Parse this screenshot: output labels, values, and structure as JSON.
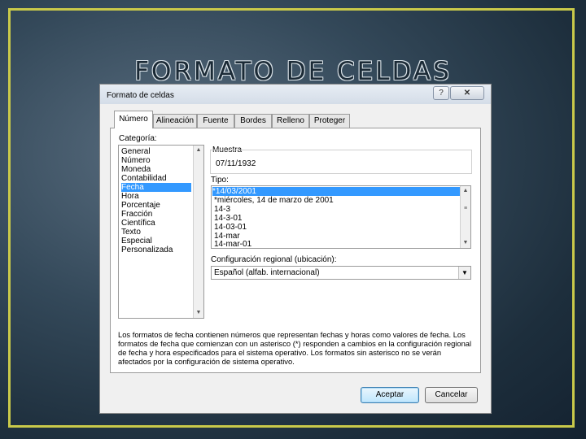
{
  "slide": {
    "title": "FORMATO DE CELDAS"
  },
  "dialog": {
    "title": "Formato de celdas",
    "help_button": "?",
    "close_button": "✕",
    "tabs": [
      "Número",
      "Alineación",
      "Fuente",
      "Bordes",
      "Relleno",
      "Proteger"
    ],
    "category_label": "Categoría:",
    "categories": [
      "General",
      "Número",
      "Moneda",
      "Contabilidad",
      "Fecha",
      "Hora",
      "Porcentaje",
      "Fracción",
      "Científica",
      "Texto",
      "Especial",
      "Personalizada"
    ],
    "selected_category": "Fecha",
    "sample_label": "Muestra",
    "sample_value": "07/11/1932",
    "type_label": "Tipo:",
    "types": [
      "*14/03/2001",
      "*miércoles, 14 de marzo de 2001",
      "14-3",
      "14-3-01",
      "14-03-01",
      "14-mar",
      "14-mar-01"
    ],
    "selected_type": "*14/03/2001",
    "locale_label": "Configuración regional (ubicación):",
    "locale_value": "Español (alfab. internacional)",
    "description": "Los formatos de fecha contienen números que representan fechas y horas como valores de fecha. Los formatos de fecha que comienzan con un asterisco (*) responden a cambios en la configuración regional de fecha y hora especificados para el sistema operativo. Los formatos sin asterisco no se verán afectados por la configuración de sistema operativo.",
    "ok_button": "Aceptar",
    "cancel_button": "Cancelar"
  },
  "colors": {
    "accent_frame": "#c9c94a",
    "selection": "#3399ff"
  }
}
